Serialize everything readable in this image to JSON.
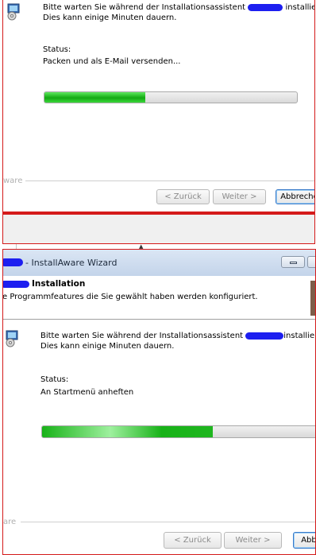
{
  "top": {
    "message_line1_pre": "Bitte warten Sie während der Installationsassistent",
    "message_line1_post": "installiert.",
    "message_line2": "Dies kann einige Minuten dauern.",
    "status_label": "Status:",
    "status_value": "Packen und als E-Mail versenden...",
    "progress_percent": 40,
    "brand": "ware",
    "back_button": "< Zurück",
    "next_button": "Weiter >",
    "cancel_button": "Abbreche"
  },
  "bottom": {
    "window_title": "- InstallAware Wizard",
    "header_title": "Installation",
    "header_subtitle": "e Programmfeatures die Sie gewählt haben werden konfiguriert.",
    "message_line1_pre": "Bitte warten Sie während der Installationsassistent",
    "message_line1_post": "installiert.",
    "message_line2": "Dies kann einige Minuten dauern.",
    "status_label": "Status:",
    "status_value": "An Startmenü anheften",
    "progress_percent": 62,
    "brand": "are",
    "back_button": "< Zurück",
    "next_button": "Weiter >",
    "cancel_button": "Abb"
  },
  "colors": {
    "redaction": "#1d1ff0",
    "progress_green": "#1eb41e",
    "frame_border": "#d41a1a"
  },
  "icons": {
    "installer": "installer-disk-icon",
    "minimize": "minimize-icon"
  }
}
